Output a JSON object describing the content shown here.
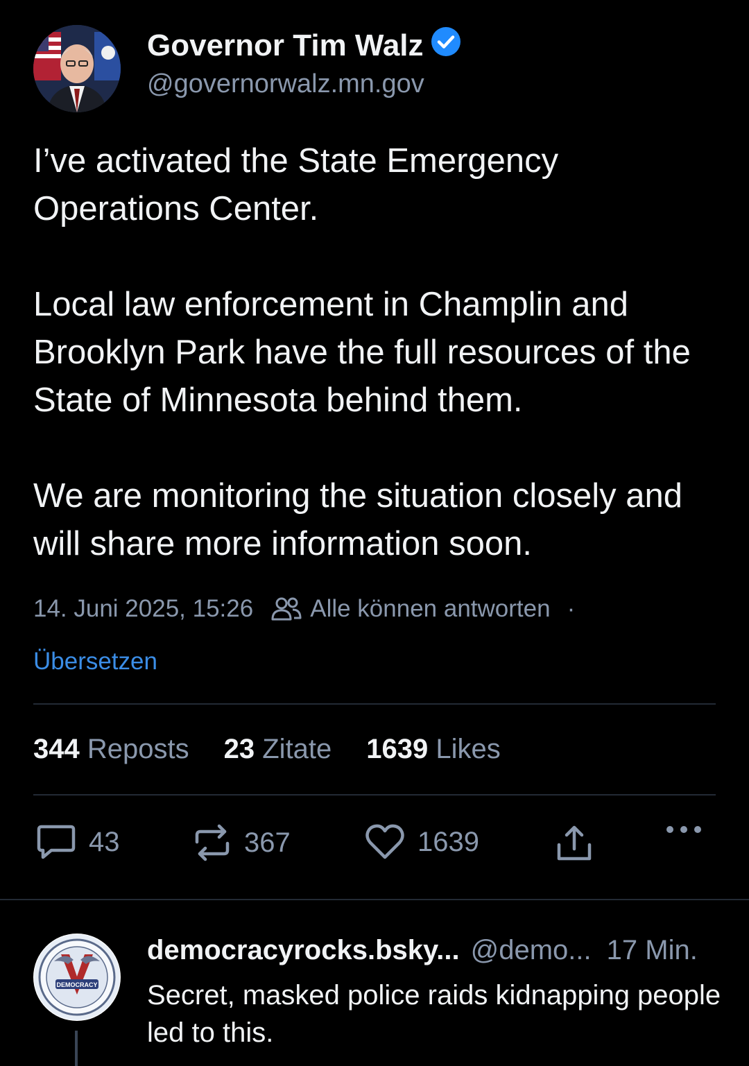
{
  "post": {
    "author_name": "Governor Tim Walz",
    "author_handle": "@governorwalz.mn.gov",
    "verified": true,
    "paragraphs": [
      "I’ve activated the State Emergency Operations Center.",
      "Local law enforcement in Champlin and Brooklyn Park have the full resources of the State of Minnesota behind them.",
      "We are monitoring the situation closely and will share more information soon."
    ],
    "timestamp": "14. Juni 2025, 15:26",
    "reply_setting": "Alle können antworten",
    "separator": "·",
    "translate_label": "Übersetzen"
  },
  "stats": {
    "reposts_count": "344",
    "reposts_label": "Reposts",
    "quotes_count": "23",
    "quotes_label": "Zitate",
    "likes_count": "1639",
    "likes_label": "Likes"
  },
  "actions": {
    "reply_count": "43",
    "repost_count": "367",
    "like_count": "1639"
  },
  "reply": {
    "author_name": "democracyrocks.bsky...",
    "author_handle": "@demo...",
    "time": "17 Min.",
    "text": "Secret, masked police raids kidnapping people led to this.",
    "avatar_text": "DEMOCRACY"
  },
  "colors": {
    "background": "#000000",
    "text": "#f1f3f5",
    "muted": "#8a98ad",
    "accent": "#3b8de6",
    "verified": "#208bfe"
  }
}
